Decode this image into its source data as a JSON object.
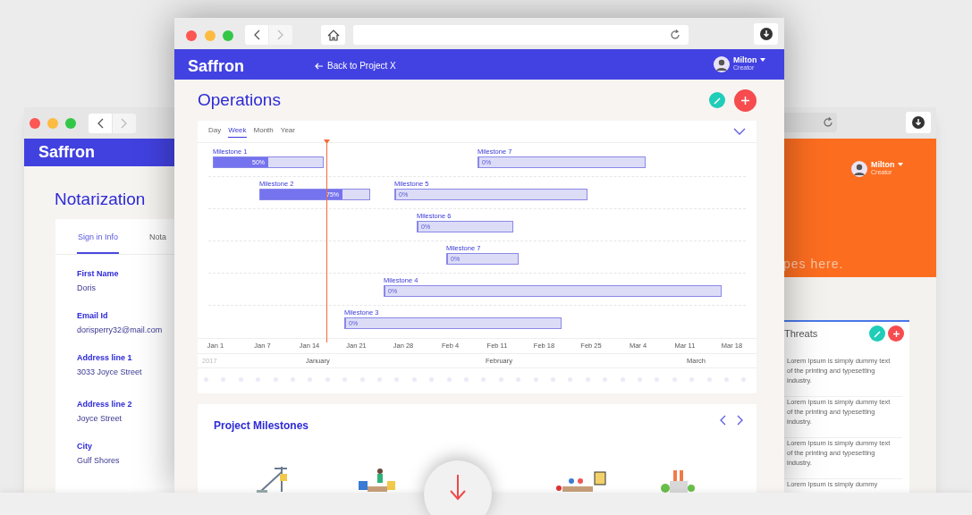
{
  "left_window": {
    "logo": "Saffron",
    "title": "Notarization",
    "tabs": [
      {
        "label": "Sign in Info",
        "selected": true
      },
      {
        "label": "Nota",
        "selected": false
      }
    ],
    "fields": [
      {
        "label": "First Name",
        "value": "Doris"
      },
      {
        "label": "Email Id",
        "value": "dorisperry32@mail.com"
      },
      {
        "label": "Address line 1",
        "value": "3033 Joyce Street"
      },
      {
        "label": "Address line 2",
        "value": "Joyce Street"
      },
      {
        "label": "City",
        "value": "Gulf Shores"
      }
    ]
  },
  "right_window": {
    "user": {
      "name": "Milton",
      "role": "Creator"
    },
    "banner_text": "pes here.",
    "threats": {
      "title": "Threats",
      "items": [
        "Lorem Ipsum is simply dummy text of the printing and typesetting industry.",
        "Lorem Ipsum is simply dummy text of the printing and typesetting industry.",
        "Lorem Ipsum is simply dummy text of the printing and typesetting industry.",
        "Lorem Ipsum is simply dummy"
      ]
    }
  },
  "main_window": {
    "logo": "Saffron",
    "back_link": "Back to Project X",
    "user": {
      "name": "Milton",
      "role": "Creator"
    },
    "page_title": "Operations",
    "gantt": {
      "views": [
        {
          "label": "Day",
          "selected": false
        },
        {
          "label": "Week",
          "selected": true
        },
        {
          "label": "Month",
          "selected": false
        },
        {
          "label": "Year",
          "selected": false
        }
      ],
      "rows": [
        {
          "milestones": [
            {
              "name": "Milestone 1",
              "level": 0.5,
              "progress": "50%"
            },
            {
              "name": "Milestone 7",
              "level": 0,
              "progress": "0%"
            }
          ]
        },
        {
          "milestones": [
            {
              "name": "Milestone 2",
              "level": 0.75,
              "progress": "75%"
            },
            {
              "name": "Milestone 5",
              "level": 0,
              "progress": "0%"
            }
          ]
        },
        {
          "milestones": [
            {
              "name": "Milestone 6",
              "level": 0,
              "progress": "0%"
            }
          ]
        },
        {
          "milestones": [
            {
              "name": "Milestone 7",
              "level": 0,
              "progress": "0%"
            }
          ]
        },
        {
          "milestones": [
            {
              "name": "Milestone 4",
              "level": 0,
              "progress": "0%"
            }
          ]
        },
        {
          "milestones": [
            {
              "name": "Milestone 3",
              "level": 0,
              "progress": "0%"
            }
          ]
        }
      ],
      "week_ticks": [
        "Jan 1",
        "Jan 7",
        "Jan 14",
        "Jan 21",
        "Jan 28",
        "Feb 4",
        "Feb 11",
        "Feb 18",
        "Feb 25",
        "Mar 4",
        "Mar 11",
        "Mar 18"
      ],
      "year": "2017",
      "months": [
        "January",
        "February",
        "March"
      ]
    },
    "milestones_card": {
      "title": "Project Milestones"
    }
  }
}
